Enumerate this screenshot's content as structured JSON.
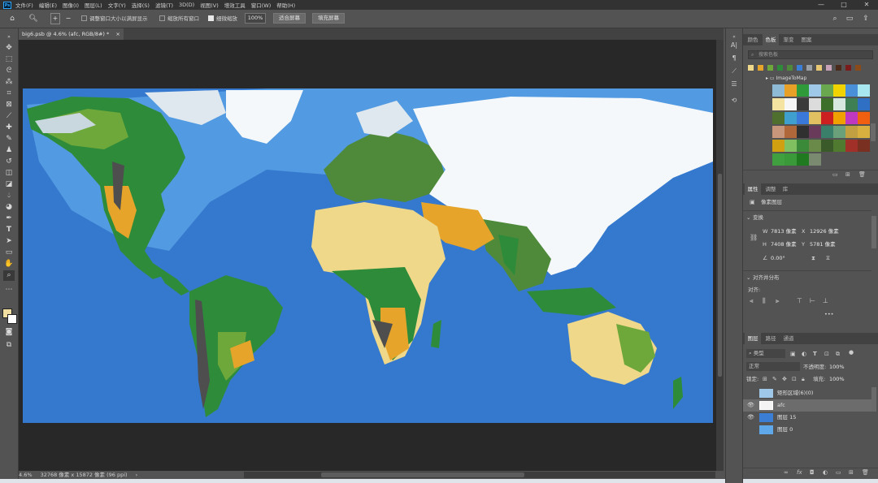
{
  "app": {
    "logo": "Ps"
  },
  "menu": [
    "文件(F)",
    "编辑(E)",
    "图像(I)",
    "图层(L)",
    "文字(Y)",
    "选择(S)",
    "滤镜(T)",
    "3D(D)",
    "视图(V)",
    "增效工具",
    "窗口(W)",
    "帮助(H)"
  ],
  "window_controls": {
    "minimize": "—",
    "maximize": "□",
    "close": "✕"
  },
  "options": {
    "resize_windows": "调整窗口大小以满屏显示",
    "zoom_all_windows": "缩放所有窗口",
    "scrubby_zoom": "细微缩放",
    "zoom_value": "100%",
    "fit_screen": "适合屏幕",
    "fill_screen": "填充屏幕",
    "scrubby_checked": true
  },
  "document": {
    "tab_title": "big6.psb @ 4.6% (afc, RGB/8#) *",
    "tab_close": "×"
  },
  "status": {
    "zoom": "4.6%",
    "info": "32768 像素 x 15872 像素 (96 ppi)",
    "arrow": "›"
  },
  "colors": {
    "ocean": "#3a7fd5",
    "ocean_deep": "#2f6fc4",
    "shelf": "#5fa8ea",
    "ice": "#f4f8fb",
    "forest": "#2e8b3a",
    "grass": "#6fa83a",
    "desert": "#efd88a",
    "savanna": "#e6a52a",
    "mountain": "#4e4e4e",
    "swatch_fg": "#f0dfa0",
    "swatch_bg": "#ffffff"
  },
  "swatches_panel": {
    "tabs": [
      "颜色",
      "色板",
      "渐变",
      "图案"
    ],
    "active_tab": 1,
    "search_placeholder": "搜索色板",
    "group_name": "ImageToMap",
    "recent": [
      "#efd88a",
      "#e6a52a",
      "#6fa83a",
      "#2e8b3a",
      "#4e8a3a",
      "#3a7fd5",
      "#9aa0a6",
      "#e9c874",
      "#c7a1b8",
      "#4a2a1a",
      "#7a1a1a",
      "#8a4a1a"
    ],
    "grid": [
      "#8fbad6",
      "#e8a126",
      "#2f9a3a",
      "#9fc7e8",
      "#6aa84f",
      "#f0d300",
      "#4a90d9",
      "#a8e6f0",
      "#f4e3a1",
      "#f6f6f6",
      "#3a3a3a",
      "#dcdcdc",
      "#3d6e2a",
      "#d7e8e0",
      "#3e7f54",
      "#2f6fc4",
      "#4f6f2f",
      "#3fa0d0",
      "#3a78d9",
      "#e0c060",
      "#cc1f1f",
      "#f0a000",
      "#c038c0",
      "#f06010",
      "#c8967a",
      "#b0683a",
      "#303030",
      "#6a3a5a",
      "#3a7f6a",
      "#6aa07a",
      "#c0a040",
      "#d8b040",
      "#d0a010",
      "#80c060",
      "#3a8a3a",
      "#6a8a4a",
      "#3a5a2a",
      "#507a30",
      "#a03028",
      "#7a3020",
      "#40a040",
      "#3a9a3a",
      "#207a20",
      "#7a8a70"
    ]
  },
  "properties_panel": {
    "tabs": [
      "属性",
      "调整",
      "库"
    ],
    "active_tab": 0,
    "layer_type": "像素图层",
    "transform_title": "变换",
    "w_label": "W",
    "w_value": "7813 像素",
    "x_label": "X",
    "x_value": "12926 像素",
    "h_label": "H",
    "h_value": "7408 像素",
    "y_label": "Y",
    "y_value": "5781 像素",
    "angle_value": "0.00°",
    "align_title": "对齐并分布",
    "align_label": "对齐:",
    "more": "•••"
  },
  "layers_panel": {
    "tabs": [
      "图层",
      "路径",
      "通道"
    ],
    "active_tab": 0,
    "filter_kind": "类型",
    "blend_mode": "正常",
    "opacity_label": "不透明度:",
    "opacity_value": "100%",
    "lock_label": "锁定:",
    "fill_label": "填充:",
    "fill_value": "100%",
    "layers": [
      {
        "name": "矩形区域(6)(0)",
        "visible": false,
        "active": false
      },
      {
        "name": "afc",
        "visible": true,
        "active": true
      },
      {
        "name": "图层 15",
        "visible": true,
        "active": false
      },
      {
        "name": "图层 0",
        "visible": false,
        "active": false
      }
    ],
    "footer_icons": [
      "link-icon",
      "fx-icon",
      "mask-icon",
      "adjustment-icon",
      "group-icon",
      "new-layer-icon",
      "delete-icon"
    ]
  }
}
